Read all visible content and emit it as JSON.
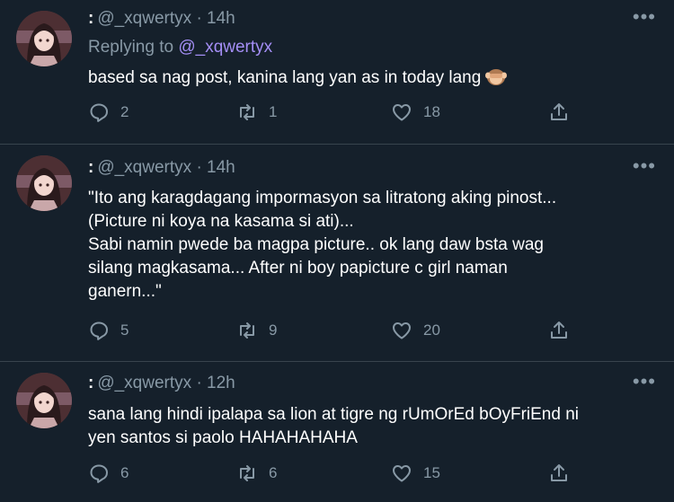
{
  "tweets": [
    {
      "handle": "@_xqwertyx",
      "time": "14h",
      "replying_label": "Replying to",
      "replying_to": "@_xqwertyx",
      "text": "based sa nag post, kanina lang yan as in today lang",
      "emoji": "see-no-evil-monkey",
      "replies": "2",
      "retweets": "1",
      "likes": "18"
    },
    {
      "handle": "@_xqwertyx",
      "time": "14h",
      "text": "\"Ito ang karagdagang impormasyon sa litratong aking pinost...\n(Picture ni koya na kasama si ati)...\nSabi namin pwede ba magpa picture.. ok lang daw bsta wag\nsilang magkasama... After ni boy papicture c girl naman\nganern...\"",
      "replies": "5",
      "retweets": "9",
      "likes": "20"
    },
    {
      "handle": "@_xqwertyx",
      "time": "12h",
      "text": "sana lang hindi ipalapa sa lion at tigre ng rUmOrEd bOyFriEnd ni\nyen santos si paolo HAHAHAHAHA",
      "replies": "6",
      "retweets": "6",
      "likes": "15"
    }
  ],
  "separator": "·",
  "colors": {
    "background": "#15202b",
    "muted": "#8899a6",
    "mention": "#a48ef5",
    "divider": "#38444d"
  },
  "icons": [
    "reply-icon",
    "retweet-icon",
    "like-icon",
    "share-icon",
    "more-icon"
  ]
}
